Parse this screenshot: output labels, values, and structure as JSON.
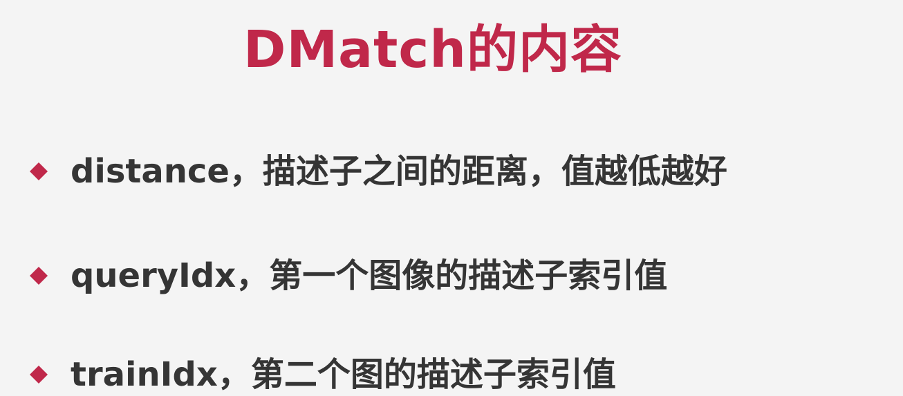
{
  "slide": {
    "title": "DMatch的内容",
    "bullets": [
      {
        "text": "distance，描述子之间的距离，值越低越好"
      },
      {
        "text": "queryIdx，第一个图像的描述子索引值"
      },
      {
        "text": "trainIdx，第二个图的描述子索引值"
      }
    ],
    "colors": {
      "accent": "#c0284a",
      "text": "#353535",
      "background": "#f4f4f4"
    },
    "icon": "diamond-bullet-icon"
  }
}
